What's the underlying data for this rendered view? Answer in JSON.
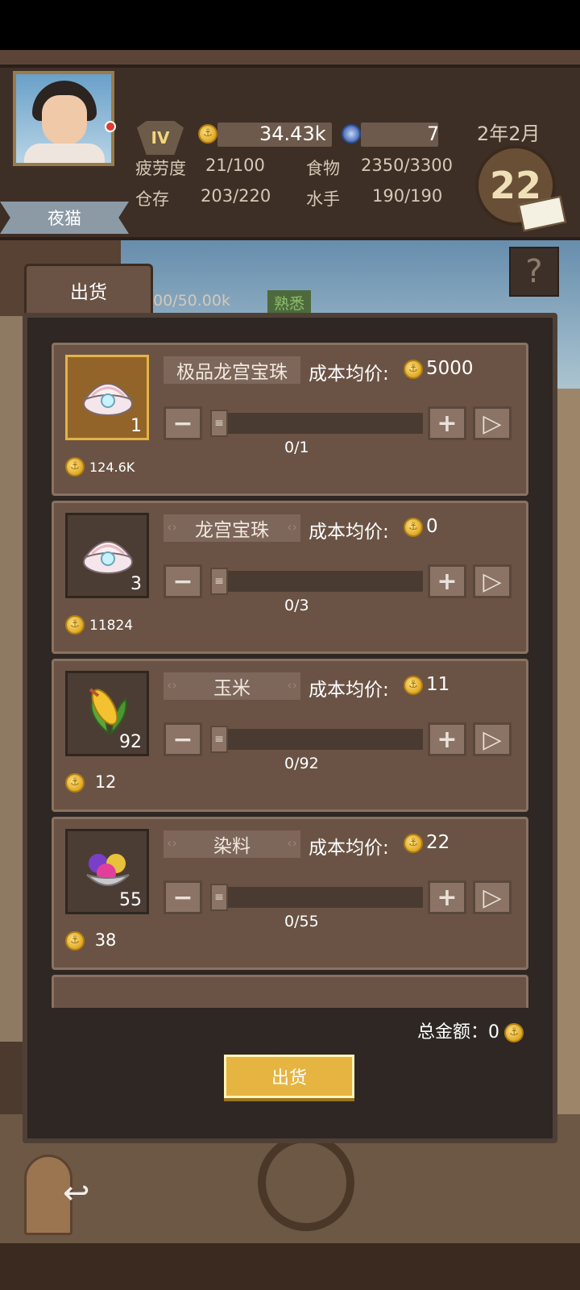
{
  "player": {
    "name": "夜猫",
    "rank": "IV"
  },
  "hud": {
    "gold": "34.43k",
    "gems": "7",
    "fatigue_label": "疲劳度",
    "fatigue_value": "21/100",
    "food_label": "食物",
    "food_value": "2350/3300",
    "storage_label": "仓存",
    "storage_value": "203/220",
    "sailors_label": "水手",
    "sailors_value": "190/190",
    "date": "2年2月",
    "day": "22",
    "help": "?"
  },
  "tab": {
    "label": "出货",
    "progress_peek": "00/50.00k",
    "badge": "熟悉"
  },
  "items": [
    {
      "name": "极品龙宫宝珠",
      "icon": "shell-pearl-icon",
      "qty": "1",
      "price": "124.6K",
      "cost_label": "成本均价:",
      "cost": "5000",
      "count": "0/1",
      "highlight": true
    },
    {
      "name": "龙宫宝珠",
      "icon": "shell-pearl-icon",
      "qty": "3",
      "price": "11824",
      "cost_label": "成本均价:",
      "cost": "0",
      "count": "0/3",
      "highlight": false
    },
    {
      "name": "玉米",
      "icon": "corn-icon",
      "qty": "92",
      "price": "12",
      "cost_label": "成本均价:",
      "cost": "11",
      "count": "0/92",
      "highlight": false
    },
    {
      "name": "染料",
      "icon": "dye-icon",
      "qty": "55",
      "price": "38",
      "cost_label": "成本均价:",
      "cost": "22",
      "count": "0/55",
      "highlight": false
    }
  ],
  "controls": {
    "minus": "−",
    "plus": "+",
    "max": "▷"
  },
  "footer": {
    "total_label": "总金额：",
    "total_value": "0",
    "sell_button": "出货"
  },
  "colors": {
    "accent_gold": "#e6b440",
    "panel": "#2e2723",
    "card": "#6a5345"
  }
}
